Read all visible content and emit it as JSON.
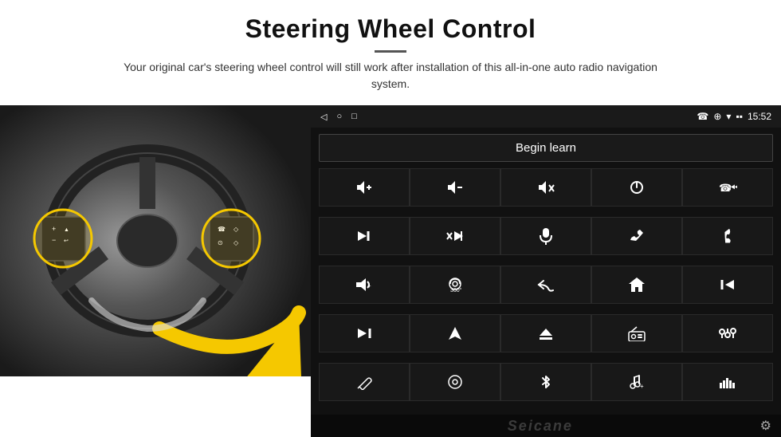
{
  "header": {
    "title": "Steering Wheel Control",
    "subtitle": "Your original car's steering wheel control will still work after installation of this all-in-one auto radio navigation system."
  },
  "radio_screen": {
    "status_bar": {
      "nav_icons": [
        "◁",
        "○",
        "□"
      ],
      "right_info": "☎  ⊕  ▾  15:52",
      "time": "15:52",
      "signal_icons": "▪▪"
    },
    "begin_learn_label": "Begin learn",
    "icon_rows": [
      [
        "🔊+",
        "🔊–",
        "🔊✕",
        "⏻",
        "☎⏮"
      ],
      [
        "⏭|",
        "✕⏭",
        "🎤",
        "☎",
        "↩"
      ],
      [
        "📢",
        "🔄360",
        "↩",
        "🏠",
        "⏮⏮"
      ],
      [
        "⏭⏭",
        "▶",
        "⊖",
        "📻",
        "⚙"
      ],
      [
        "🎤",
        "⊕",
        "✱",
        "🎵",
        "📊"
      ]
    ],
    "bottom": {
      "brand": "Seicane",
      "gear": "⚙"
    }
  },
  "icons": {
    "vol_up": "🔊",
    "vol_down": "🔉",
    "mute": "🔇",
    "power": "⏻",
    "phone_prev": "📞",
    "next": "⏭",
    "mic": "🎤",
    "phone": "📞",
    "hang_up": "📵",
    "horn": "📢",
    "camera_360": "📷",
    "back": "↩",
    "home": "🏠",
    "prev": "⏮",
    "fast_fwd": "⏩",
    "navigate": "➤",
    "eject": "⏏",
    "radio": "📻",
    "equalizer": "🎛",
    "pen": "✏",
    "settings_circle": "⊙",
    "bluetooth": "⚡",
    "music": "🎵",
    "spectrum": "📊",
    "gear": "⚙"
  },
  "icon_grid_symbols": [
    {
      "sym": "vol+",
      "unicode": "🔊"
    },
    {
      "sym": "vol-",
      "unicode": "🔉"
    },
    {
      "sym": "mute",
      "unicode": "🔇"
    },
    {
      "sym": "power",
      "unicode": "⏻"
    },
    {
      "sym": "call-prev",
      "unicode": "📞"
    },
    {
      "sym": "skip-next",
      "unicode": "⏭"
    },
    {
      "sym": "mute-next",
      "unicode": "✕"
    },
    {
      "sym": "mic",
      "unicode": "🎤"
    },
    {
      "sym": "phone",
      "unicode": "☎"
    },
    {
      "sym": "hang-up",
      "unicode": "↪"
    },
    {
      "sym": "horn",
      "unicode": "📢"
    },
    {
      "sym": "360cam",
      "unicode": "↻"
    },
    {
      "sym": "back",
      "unicode": "↩"
    },
    {
      "sym": "home",
      "unicode": "⌂"
    },
    {
      "sym": "skip-prev",
      "unicode": "⏮"
    },
    {
      "sym": "fast-fwd",
      "unicode": "⏩"
    },
    {
      "sym": "navigate",
      "unicode": "➤"
    },
    {
      "sym": "eject",
      "unicode": "⏏"
    },
    {
      "sym": "radio",
      "unicode": "📻"
    },
    {
      "sym": "equalizer",
      "unicode": "🎛"
    },
    {
      "sym": "pen",
      "unicode": "✏"
    },
    {
      "sym": "settings-o",
      "unicode": "◎"
    },
    {
      "sym": "bluetooth",
      "unicode": "✳"
    },
    {
      "sym": "music",
      "unicode": "♫"
    },
    {
      "sym": "spectrum",
      "unicode": "▊"
    }
  ]
}
